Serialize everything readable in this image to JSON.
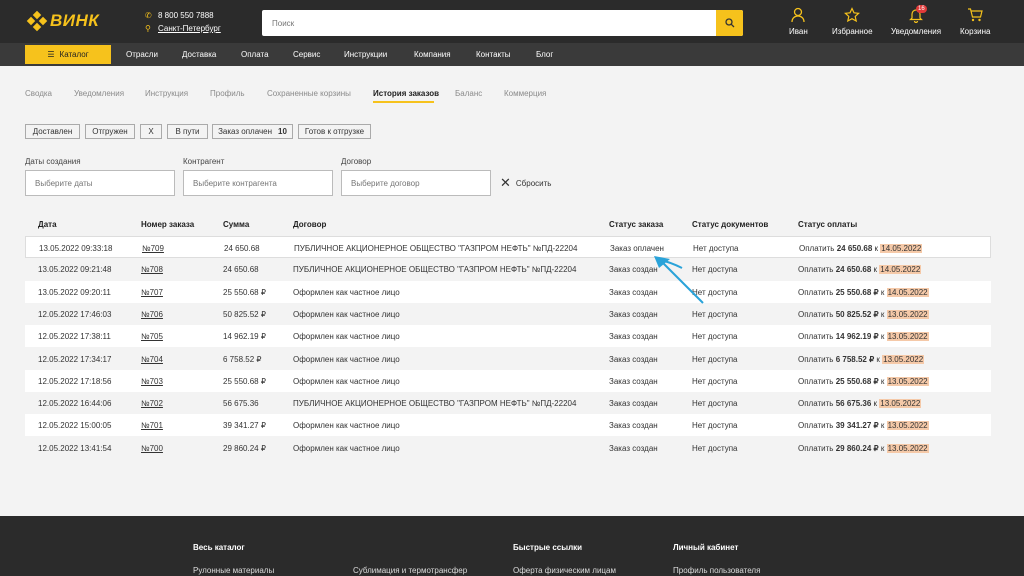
{
  "header": {
    "logo": "ВИНК",
    "phone": "8 800 550 7888",
    "city": "Санкт-Петербург",
    "search_placeholder": "Поиск",
    "icons": [
      {
        "label": "Иван",
        "icon": "user-icon"
      },
      {
        "label": "Избранное",
        "icon": "star-icon"
      },
      {
        "label": "Уведомления",
        "icon": "bell-icon",
        "badge": "16"
      },
      {
        "label": "Корзина",
        "icon": "cart-icon"
      }
    ]
  },
  "nav": {
    "catalog": "Каталог",
    "items": [
      "Отрасли",
      "Доставка",
      "Оплата",
      "Сервис",
      "Инструкции",
      "Компания",
      "Контакты",
      "Блог"
    ]
  },
  "tabs": [
    "Сводка",
    "Уведомления",
    "Инструкция",
    "Профиль",
    "Сохраненные корзины",
    "История заказов",
    "Баланс",
    "Коммерция"
  ],
  "active_tab": "История заказов",
  "chips": [
    {
      "label": "Доставлен"
    },
    {
      "label": "Отгружен"
    },
    {
      "label": "Х"
    },
    {
      "label": "В пути"
    },
    {
      "label": "Заказ оплачен",
      "count": "10"
    },
    {
      "label": "Готов к отгрузке"
    }
  ],
  "filters": {
    "date_label": "Даты создания",
    "date_placeholder": "Выберите даты",
    "contractor_label": "Контрагент",
    "contractor_placeholder": "Выберите контрагента",
    "contract_label": "Договор",
    "contract_placeholder": "Выберите договор",
    "reset": "Сбросить"
  },
  "table": {
    "columns": [
      "Дата",
      "Номер заказа",
      "Сумма",
      "Договор",
      "Статус заказа",
      "Статус документов",
      "Статус оплаты"
    ],
    "rows": [
      {
        "date": "13.05.2022 09:33:18",
        "num": "№709",
        "sum": "24 650.68",
        "contract": "ПУБЛИЧНОЕ АКЦИОНЕРНОЕ ОБЩЕСТВО \"ГАЗПРОМ НЕФТЬ\" №ПД-22204",
        "status": "Заказ оплачен",
        "docs": "Нет доступа",
        "pay_prefix": "Оплатить",
        "pay_amount": "24 650.68",
        "pay_k": "к",
        "pay_date": "14.05.2022"
      },
      {
        "date": "13.05.2022 09:21:48",
        "num": "№708",
        "sum": "24 650.68",
        "contract": "ПУБЛИЧНОЕ АКЦИОНЕРНОЕ ОБЩЕСТВО \"ГАЗПРОМ НЕФТЬ\" №ПД-22204",
        "status": "Заказ создан",
        "docs": "Нет доступа",
        "pay_prefix": "Оплатить",
        "pay_amount": "24 650.68",
        "pay_k": "к",
        "pay_date": "14.05.2022"
      },
      {
        "date": "13.05.2022 09:20:11",
        "num": "№707",
        "sum": "25 550.68 ₽",
        "contract": "Оформлен как частное лицо",
        "status": "Заказ создан",
        "docs": "Нет доступа",
        "pay_prefix": "Оплатить",
        "pay_amount": "25 550.68 ₽",
        "pay_k": "к",
        "pay_date": "14.05.2022"
      },
      {
        "date": "12.05.2022 17:46:03",
        "num": "№706",
        "sum": "50 825.52 ₽",
        "contract": "Оформлен как частное лицо",
        "status": "Заказ создан",
        "docs": "Нет доступа",
        "pay_prefix": "Оплатить",
        "pay_amount": "50 825.52 ₽",
        "pay_k": "к",
        "pay_date": "13.05.2022"
      },
      {
        "date": "12.05.2022 17:38:11",
        "num": "№705",
        "sum": "14 962.19 ₽",
        "contract": "Оформлен как частное лицо",
        "status": "Заказ создан",
        "docs": "Нет доступа",
        "pay_prefix": "Оплатить",
        "pay_amount": "14 962.19 ₽",
        "pay_k": "к",
        "pay_date": "13.05.2022"
      },
      {
        "date": "12.05.2022 17:34:17",
        "num": "№704",
        "sum": "6 758.52 ₽",
        "contract": "Оформлен как частное лицо",
        "status": "Заказ создан",
        "docs": "Нет доступа",
        "pay_prefix": "Оплатить",
        "pay_amount": "6 758.52 ₽",
        "pay_k": "к",
        "pay_date": "13.05.2022"
      },
      {
        "date": "12.05.2022 17:18:56",
        "num": "№703",
        "sum": "25 550.68 ₽",
        "contract": "Оформлен как частное лицо",
        "status": "Заказ создан",
        "docs": "Нет доступа",
        "pay_prefix": "Оплатить",
        "pay_amount": "25 550.68 ₽",
        "pay_k": "к",
        "pay_date": "13.05.2022"
      },
      {
        "date": "12.05.2022 16:44:06",
        "num": "№702",
        "sum": "56 675.36",
        "contract": "ПУБЛИЧНОЕ АКЦИОНЕРНОЕ ОБЩЕСТВО \"ГАЗПРОМ НЕФТЬ\" №ПД-22204",
        "status": "Заказ создан",
        "docs": "Нет доступа",
        "pay_prefix": "Оплатить",
        "pay_amount": "56 675.36",
        "pay_k": "к",
        "pay_date": "13.05.2022"
      },
      {
        "date": "12.05.2022 15:00:05",
        "num": "№701",
        "sum": "39 341.27 ₽",
        "contract": "Оформлен как частное лицо",
        "status": "Заказ создан",
        "docs": "Нет доступа",
        "pay_prefix": "Оплатить",
        "pay_amount": "39 341.27 ₽",
        "pay_k": "к",
        "pay_date": "13.05.2022"
      },
      {
        "date": "12.05.2022 13:41:54",
        "num": "№700",
        "sum": "29 860.24 ₽",
        "contract": "Оформлен как частное лицо",
        "status": "Заказ создан",
        "docs": "Нет доступа",
        "pay_prefix": "Оплатить",
        "pay_amount": "29 860.24 ₽",
        "pay_k": "к",
        "pay_date": "13.05.2022"
      }
    ]
  },
  "footer": {
    "headings": [
      "Весь каталог",
      "Быстрые ссылки",
      "Личный кабинет"
    ],
    "links": [
      "Рулонные материалы",
      "Сублимация и термотрансфер",
      "Оферта физическим лицам",
      "Профиль пользователя"
    ]
  },
  "colors": {
    "accent": "#f6c21c",
    "dark": "#2b2b2b",
    "annotation_arrow": "#2aa3d9",
    "date_highlight": "#f5c9a8"
  }
}
